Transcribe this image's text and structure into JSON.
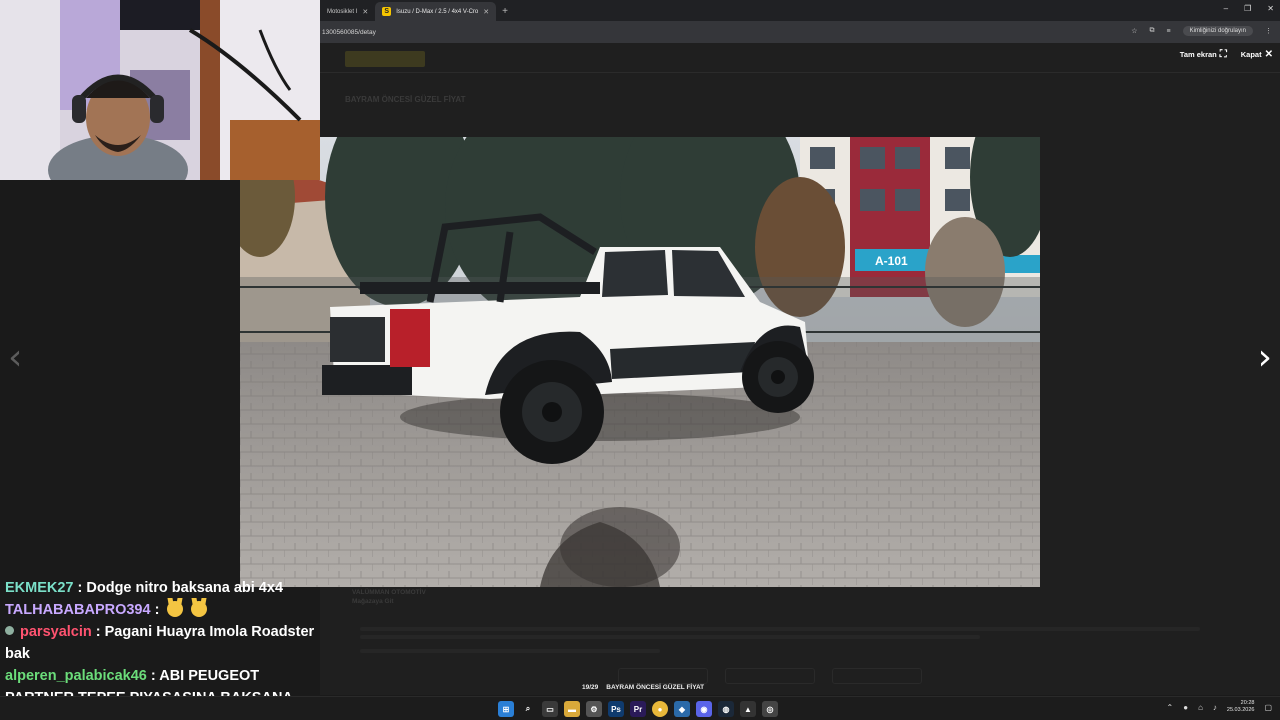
{
  "browser": {
    "tabs": [
      {
        "label": "Motosiklet I",
        "close": "✕",
        "active": false
      },
      {
        "label": "Isuzu / D-Max / 2.5 / 4x4 V-Cro",
        "close": "✕",
        "active": true
      }
    ],
    "new_tab": "+",
    "url": "1300560085/detay",
    "profile_label": "Kimliğinizi doğrulayın",
    "window_controls": [
      "–",
      "❐",
      "✕"
    ]
  },
  "page": {
    "ghost_title": "BAYRAM ÖNCESİ GÜZEL FİYAT",
    "ghost_seller_1": "VALÜMMAN OTOMOTİV",
    "ghost_seller_2": "Mağazaya Git"
  },
  "lightbox": {
    "fullscreen_label": "Tam ekran",
    "close_label": "Kapat",
    "prev_arrow": "‹",
    "next_arrow": "›",
    "counter": "19/29",
    "caption": "BAYRAM ÖNCESİ GÜZEL FİYAT",
    "shop_sign": "A-101"
  },
  "chat": [
    {
      "user": "EKMEK27",
      "sep": " : ",
      "text": "Dodge nitro baksana abi 4x4"
    },
    {
      "user": "TALHABABAPRO394",
      "sep": " : ",
      "text": ""
    },
    {
      "user": "parsyalcin",
      "sep": " : ",
      "text": "Pagani Huayra Imola Roadster bak"
    },
    {
      "user": "alperen_palabicak46",
      "sep": " : ",
      "text": "ABI PEUGEOT PARTNER TEPEE PIYASASINA BAKSANA"
    }
  ],
  "taskbar": {
    "time": "20:28",
    "date": "25.03.2026"
  },
  "colors": {
    "accent_yellow": "#f7c600",
    "chat_user1": "#7be0c9",
    "chat_user2": "#c8a9ff",
    "chat_user3": "#ff5370",
    "chat_user4": "#6bdd7a"
  }
}
